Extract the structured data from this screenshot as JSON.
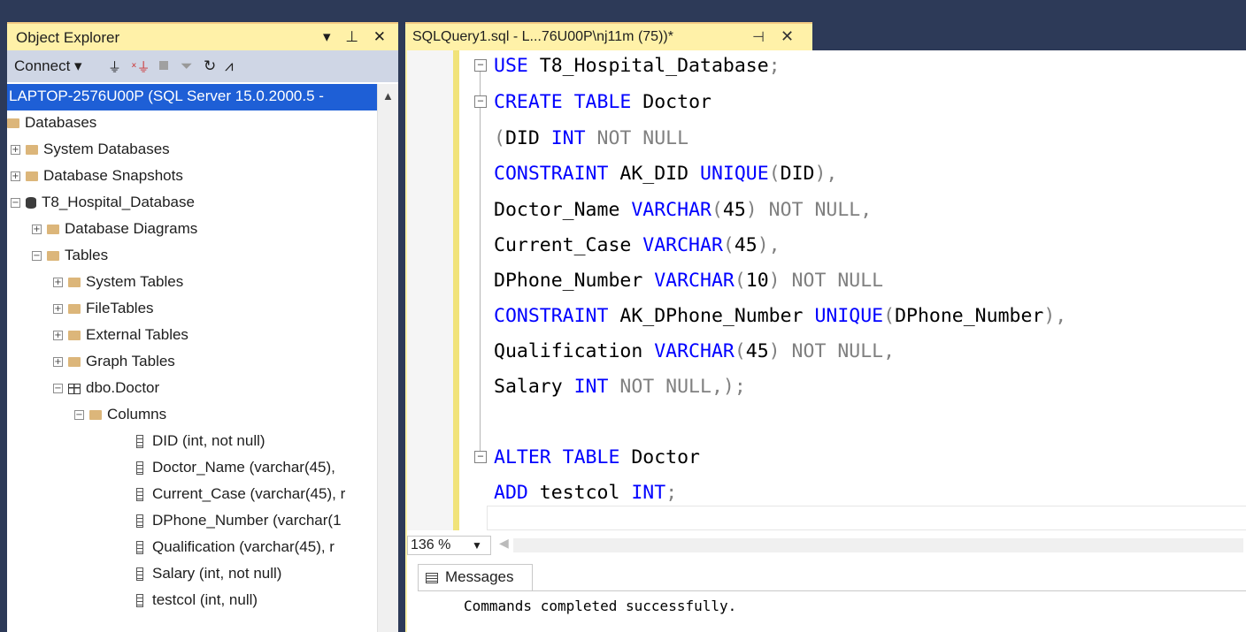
{
  "object_explorer": {
    "title": "Object Explorer",
    "title_buttons": "▾ ⊥ ✕",
    "toolbar": {
      "connect_label": "Connect ▾",
      "connect_icon": "plug-icon",
      "disconnect_icon": "unplug-icon",
      "stop_icon": "stop-icon",
      "filter_icon": "filter-icon",
      "refresh_icon": "refresh-icon",
      "activity_icon": "activity-monitor-icon"
    },
    "tree": {
      "server": "LAPTOP-2576U00P (SQL Server 15.0.2000.5 -",
      "databases": "Databases",
      "system_databases": "System Databases",
      "database_snapshots": "Database Snapshots",
      "hospital_db": "T8_Hospital_Database",
      "database_diagrams": "Database Diagrams",
      "tables": "Tables",
      "system_tables": "System Tables",
      "file_tables": "FileTables",
      "external_tables": "External Tables",
      "graph_tables": "Graph Tables",
      "doctor_table": "dbo.Doctor",
      "columns": "Columns",
      "col_did": "DID (int, not null)",
      "col_doctor_name": "Doctor_Name (varchar(45),",
      "col_current_case": "Current_Case (varchar(45), r",
      "col_dphone": "DPhone_Number (varchar(1",
      "col_qualification": "Qualification (varchar(45), r",
      "col_salary": "Salary (int, not null)",
      "col_testcol": "testcol (int, null)"
    }
  },
  "editor": {
    "tab_title": "SQLQuery1.sql - L...76U00P\\nj11m (75))*",
    "tab_pin": "⊣",
    "tab_close": "✕",
    "code": {
      "l1_kw": "USE",
      "l1_rest": " T8_Hospital_Database",
      "l2_kw": "CREATE TABLE",
      "l2_rest": " Doctor",
      "l3_p": "(",
      "l3_name": "DID ",
      "l3_kw": "INT",
      "l3_gr": " NOT NULL",
      "l4_kw": "CONSTRAINT",
      "l4_name": " AK_DID ",
      "l4_kw2": "UNIQUE",
      "l4_gr": "(",
      "l4_col": "DID",
      "l4_end": "),",
      "l5_name": "Doctor_Name ",
      "l5_kw": "VARCHAR",
      "l5_gr": "(",
      "l5_n": "45",
      "l5_end": ") NOT NULL,",
      "l6_name": "Current_Case ",
      "l6_kw": "VARCHAR",
      "l6_gr": "(",
      "l6_n": "45",
      "l6_end": "),",
      "l7_name": "DPhone_Number ",
      "l7_kw": "VARCHAR",
      "l7_gr": "(",
      "l7_n": "10",
      "l7_end": ") NOT NULL",
      "l8_kw": "CONSTRAINT",
      "l8_name": " AK_DPhone_Number ",
      "l8_kw2": "UNIQUE",
      "l8_gr": "(",
      "l8_col": "DPhone_Number",
      "l8_end": "),",
      "l9_name": "Qualification ",
      "l9_kw": "VARCHAR",
      "l9_gr": "(",
      "l9_n": "45",
      "l9_end": ") NOT NULL,",
      "l10_name": "Salary ",
      "l10_kw": "INT",
      "l10_gr": " NOT NULL,);",
      "l12_kw": "ALTER TABLE",
      "l12_rest": " Doctor",
      "l13_kw": "ADD",
      "l13_name": " testcol ",
      "l13_kw2": "INT",
      "l13_end": ";"
    },
    "zoom": "136 %"
  },
  "results": {
    "tab_label": "Messages",
    "message": "Commands completed successfully."
  },
  "colors": {
    "keyword": "#0000ff",
    "gray": "#808080",
    "active_tab": "#fff1a8",
    "selection": "#1e5fd6",
    "frame": "#2d3a58"
  }
}
